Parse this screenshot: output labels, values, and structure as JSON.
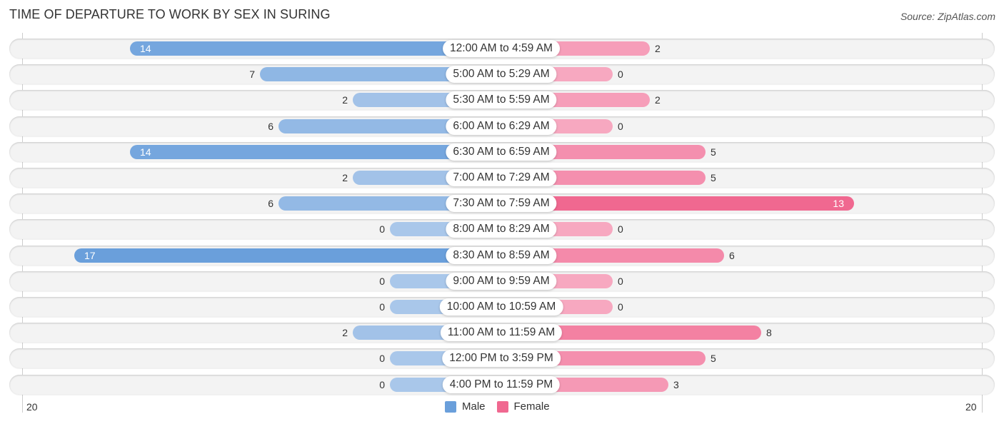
{
  "title": "TIME OF DEPARTURE TO WORK BY SEX IN SURING",
  "source": "Source: ZipAtlas.com",
  "colors": {
    "male_strong": "#6a9fdb",
    "male_light": "#a9c7ea",
    "female_strong": "#f06890",
    "female_light": "#f7a8c0"
  },
  "chart_data": {
    "type": "bar",
    "orientation": "horizontal-diverging",
    "title": "TIME OF DEPARTURE TO WORK BY SEX IN SURING",
    "categories": [
      "12:00 AM to 4:59 AM",
      "5:00 AM to 5:29 AM",
      "5:30 AM to 5:59 AM",
      "6:00 AM to 6:29 AM",
      "6:30 AM to 6:59 AM",
      "7:00 AM to 7:29 AM",
      "7:30 AM to 7:59 AM",
      "8:00 AM to 8:29 AM",
      "8:30 AM to 8:59 AM",
      "9:00 AM to 9:59 AM",
      "10:00 AM to 10:59 AM",
      "11:00 AM to 11:59 AM",
      "12:00 PM to 3:59 PM",
      "4:00 PM to 11:59 PM"
    ],
    "series": [
      {
        "name": "Male",
        "values": [
          14,
          7,
          2,
          6,
          14,
          2,
          6,
          0,
          17,
          0,
          0,
          2,
          0,
          0
        ]
      },
      {
        "name": "Female",
        "values": [
          2,
          0,
          2,
          0,
          5,
          5,
          13,
          0,
          6,
          0,
          0,
          8,
          5,
          3
        ]
      }
    ],
    "axis": {
      "left_tick": "20",
      "right_tick": "20",
      "range": [
        -20,
        20
      ]
    },
    "legend": {
      "position": "bottom-center",
      "entries": [
        "Male",
        "Female"
      ]
    }
  }
}
